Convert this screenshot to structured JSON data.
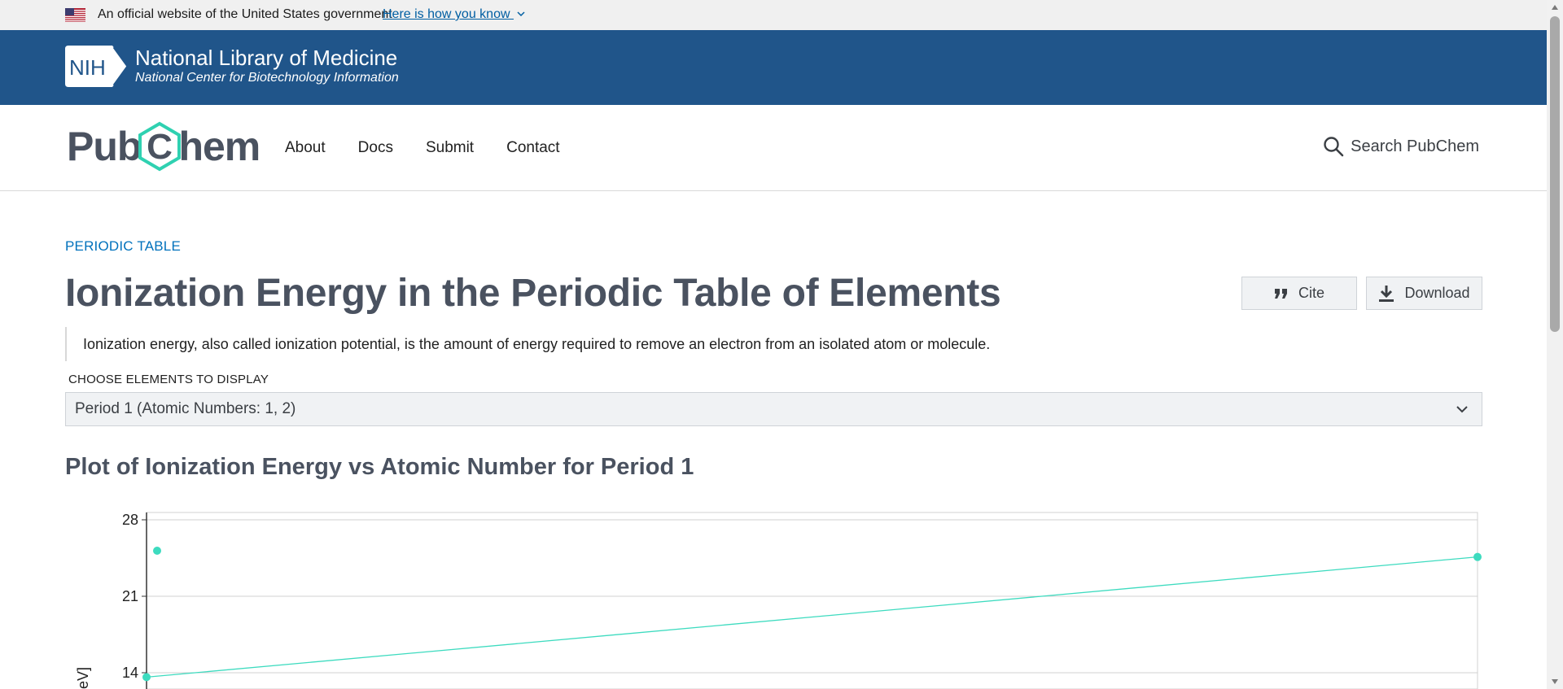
{
  "gov_banner": {
    "text": "An official website of the United States government",
    "link": "Here is how you know"
  },
  "nlm": {
    "logo_text": "NIH",
    "title": "National Library of Medicine",
    "subtitle": "National Center for Biotechnology Information"
  },
  "pubchem": {
    "logo_left": "Pub",
    "logo_mid": "C",
    "logo_right": "hem",
    "nav": [
      "About",
      "Docs",
      "Submit",
      "Contact"
    ],
    "search_label": "Search PubChem"
  },
  "page": {
    "eyebrow": "PERIODIC TABLE",
    "title": "Ionization Energy in the Periodic Table of Elements",
    "cite_label": "Cite",
    "download_label": "Download",
    "description": "Ionization energy, also called ionization potential, is the amount of energy required to remove an electron from an isolated atom or molecule.",
    "choose_label": "CHOOSE ELEMENTS TO DISPLAY",
    "selected_option": "Period 1 (Atomic Numbers: 1, 2)",
    "plot_title": "Plot of Ionization Energy vs Atomic Number for Period 1"
  },
  "colors": {
    "series": "#3ddbbf",
    "header_blue": "#20558a",
    "link_blue": "#0071bc",
    "title_gray": "#4a5260"
  },
  "chart_data": {
    "type": "line",
    "ylabel_visible": "eV]",
    "yticks": [
      28,
      21,
      14
    ],
    "ylim": [
      10.6,
      28
    ],
    "x": [
      1,
      2
    ],
    "series": [
      {
        "values": [
          13.6,
          24.6
        ]
      }
    ],
    "grid": true
  }
}
